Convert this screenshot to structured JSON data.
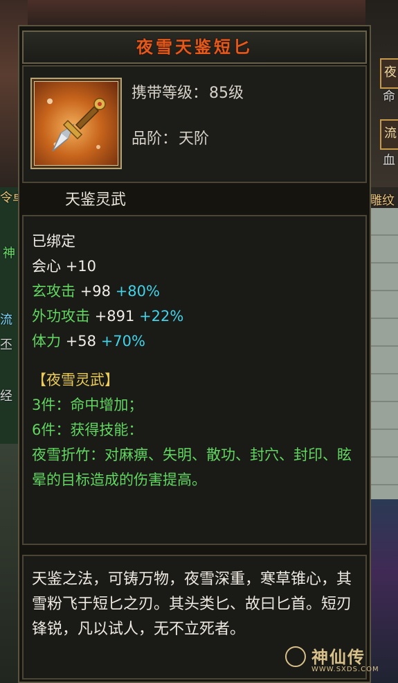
{
  "item": {
    "name": "夜雪天鉴短匕",
    "level_label": "携带等级：",
    "level_value": "85级",
    "grade_label": "品阶：",
    "grade_value": "天阶",
    "set_name": "天鉴灵武",
    "icon": "dagger-icon"
  },
  "stats": {
    "bound": "已绑定",
    "crit_label": "会心",
    "crit_value": "+10",
    "xuan_label": "玄攻击",
    "xuan_value": "+98",
    "xuan_pct": "+80%",
    "outer_label": "外功攻击",
    "outer_value": "+891",
    "outer_pct": "+22%",
    "stamina_label": "体力",
    "stamina_value": "+58",
    "stamina_pct": "+70%"
  },
  "set_bonus": {
    "title": "【夜雪灵武】",
    "piece3": "3件：命中增加；",
    "piece6": "6件：获得技能：",
    "skill": "夜雪折竹：对麻痹、失明、散功、封穴、封印、眩晕的目标造成的伤害提高。"
  },
  "lore": "天鉴之法，可铸万物，夜雪深重，寒草锥心，其雪粉飞于短匕之刃。其头类匕、故曰匕首。短刃锋锐，凡以试人，无不立死者。",
  "background": {
    "right_btn_1": "夜",
    "right_btn_1b": "命",
    "right_btn_2": "流",
    "right_btn_2b": "血",
    "left_frag_1": "令卓",
    "left_frag_2": "神",
    "left_frag_3": "流",
    "left_frag_4": "丕",
    "left_frag_5": "经",
    "right_frag_1": "雕纹"
  },
  "watermark": {
    "name": "神仙传",
    "url": "WWW.SXDS.COM"
  },
  "colors": {
    "title": "#e25a1c",
    "green": "#61d661",
    "cyan": "#42d3e8",
    "gold": "#ebcc5a"
  }
}
